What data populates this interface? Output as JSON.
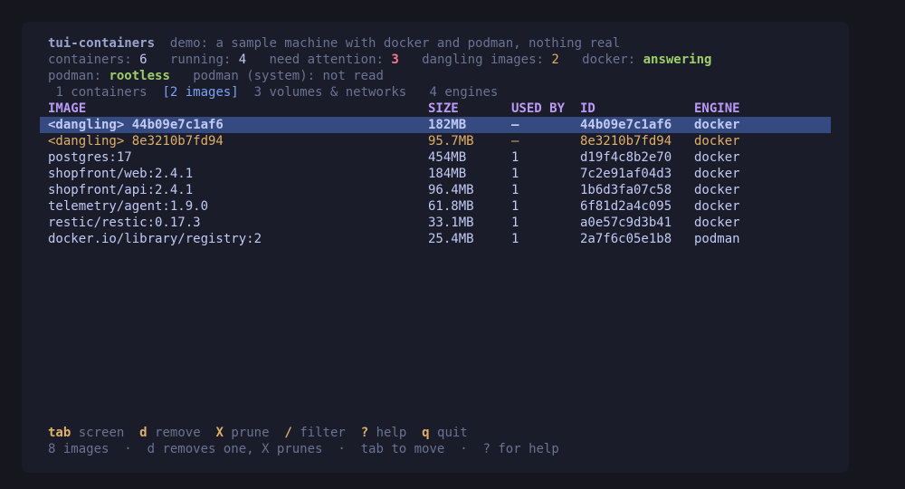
{
  "header": {
    "app_name": "tui-containers",
    "subtitle": "demo: a sample machine with docker and podman, nothing real"
  },
  "stats": {
    "containers_label": "containers:",
    "containers_value": "6",
    "running_label": "running:",
    "running_value": "4",
    "attention_label": "need attention:",
    "attention_value": "3",
    "dangling_label": "dangling images:",
    "dangling_value": "2",
    "docker_label": "docker:",
    "docker_value": "answering"
  },
  "engines": {
    "podman_label": "podman:",
    "podman_value": "rootless",
    "podman_system_label": "podman (system):",
    "podman_system_value": "not read"
  },
  "tabs": [
    {
      "label": "1 containers"
    },
    {
      "label": "[2 images]"
    },
    {
      "label": "3 volumes & networks"
    },
    {
      "label": "4 engines"
    }
  ],
  "table": {
    "columns": {
      "image": "IMAGE",
      "size": "SIZE",
      "used_by": "USED BY",
      "id": "ID",
      "engine": "ENGINE"
    },
    "rows": [
      {
        "image": "<dangling> 44b09e7c1af6",
        "size": "182MB",
        "used_by": "—",
        "id": "44b09e7c1af6",
        "engine": "docker"
      },
      {
        "image": "<dangling> 8e3210b7fd94",
        "size": "95.7MB",
        "used_by": "—",
        "id": "8e3210b7fd94",
        "engine": "docker"
      },
      {
        "image": "postgres:17",
        "size": "454MB",
        "used_by": "1",
        "id": "d19f4c8b2e70",
        "engine": "docker"
      },
      {
        "image": "shopfront/web:2.4.1",
        "size": "184MB",
        "used_by": "1",
        "id": "7c2e91af04d3",
        "engine": "docker"
      },
      {
        "image": "shopfront/api:2.4.1",
        "size": "96.4MB",
        "used_by": "1",
        "id": "1b6d3fa07c58",
        "engine": "docker"
      },
      {
        "image": "telemetry/agent:1.9.0",
        "size": "61.8MB",
        "used_by": "1",
        "id": "6f81d2a4c095",
        "engine": "docker"
      },
      {
        "image": "restic/restic:0.17.3",
        "size": "33.1MB",
        "used_by": "1",
        "id": "a0e57c9d3b41",
        "engine": "docker"
      },
      {
        "image": "docker.io/library/registry:2",
        "size": "25.4MB",
        "used_by": "1",
        "id": "2a7f6c05e1b8",
        "engine": "podman"
      }
    ]
  },
  "keys": [
    {
      "key": "tab",
      "action": "screen"
    },
    {
      "key": "d",
      "action": "remove"
    },
    {
      "key": "X",
      "action": "prune"
    },
    {
      "key": "/",
      "action": "filter"
    },
    {
      "key": "?",
      "action": "help"
    },
    {
      "key": "q",
      "action": "quit"
    }
  ],
  "status": {
    "count": "8 images",
    "hint_remove": "d removes one, X prunes",
    "hint_tab": "tab to move",
    "hint_help": "? for help",
    "separator": "·"
  },
  "colors": {
    "background": "#1b1c29",
    "selection": "#364a82",
    "dangling": "#e0af68",
    "key": "#e0af68",
    "header": "#bb9af7",
    "ok": "#9ece6a",
    "alert": "#f7768e"
  }
}
